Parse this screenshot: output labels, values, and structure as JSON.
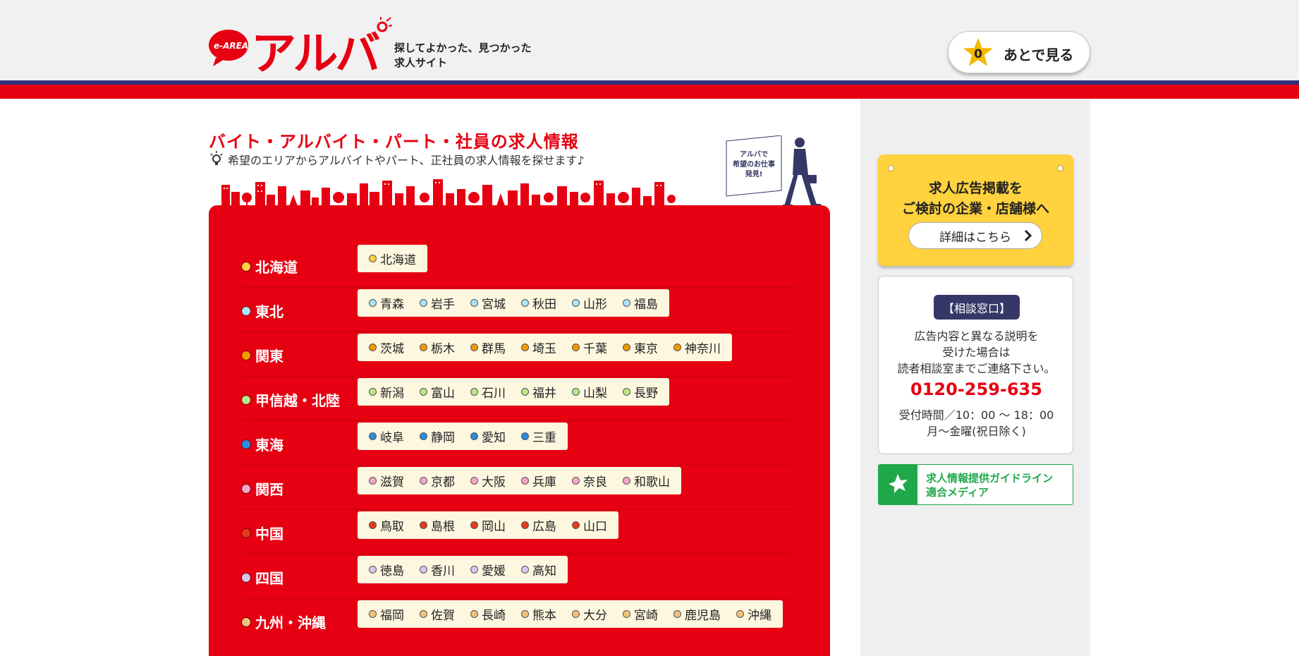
{
  "header": {
    "logo_mark_text": "e-AREA",
    "logo_text": "アルバ",
    "tagline_line1": "探してよかった、見つかった",
    "tagline_line2": "求人サイト",
    "later_count": "0",
    "later_label": "あとで見る",
    "brand_red": "#e60012",
    "brand_navy": "#2e2f7a"
  },
  "main": {
    "title": "バイト・アルバイト・パート・社員の求人情報",
    "subtitle": "希望のエリアからアルバイトやパート、正社員の求人情報を探せます♪",
    "walker_sign_line1": "アルバで",
    "walker_sign_line2": "希望のお仕事",
    "walker_sign_line3": "発見!"
  },
  "regions": [
    {
      "name": "北海道",
      "color": "#ffd23e",
      "prefectures": [
        "北海道"
      ]
    },
    {
      "name": "東北",
      "color": "#a9e4f7",
      "prefectures": [
        "青森",
        "岩手",
        "宮城",
        "秋田",
        "山形",
        "福島"
      ]
    },
    {
      "name": "関東",
      "color": "#f39800",
      "prefectures": [
        "茨城",
        "栃木",
        "群馬",
        "埼玉",
        "千葉",
        "東京",
        "神奈川"
      ]
    },
    {
      "name": "甲信越・北陸",
      "color": "#b5e887",
      "prefectures": [
        "新潟",
        "富山",
        "石川",
        "福井",
        "山梨",
        "長野"
      ]
    },
    {
      "name": "東海",
      "color": "#2a8de0",
      "prefectures": [
        "岐阜",
        "静岡",
        "愛知",
        "三重"
      ]
    },
    {
      "name": "関西",
      "color": "#f4a6c8",
      "prefectures": [
        "滋賀",
        "京都",
        "大阪",
        "兵庫",
        "奈良",
        "和歌山"
      ]
    },
    {
      "name": "中国",
      "color": "#e83a1a",
      "prefectures": [
        "鳥取",
        "島根",
        "岡山",
        "広島",
        "山口"
      ]
    },
    {
      "name": "四国",
      "color": "#d9c6ec",
      "prefectures": [
        "徳島",
        "香川",
        "愛媛",
        "高知"
      ]
    },
    {
      "name": "九州・沖縄",
      "color": "#f1c27d",
      "prefectures": [
        "福岡",
        "佐賀",
        "長崎",
        "熊本",
        "大分",
        "宮崎",
        "鹿児島",
        "沖縄"
      ]
    }
  ],
  "sidebar": {
    "ad_line1": "求人広告掲載を",
    "ad_line2": "ご検討の企業・店舗様へ",
    "ad_button": "詳細はこちら",
    "consult_badge": "【相談窓口】",
    "consult_line1": "広告内容と異なる説明を",
    "consult_line2": "受けた場合は",
    "consult_line3": "読者相談室までご連絡下さい。",
    "consult_phone": "0120-259-635",
    "consult_hours1": "受付時間／10：00 ～ 18：00",
    "consult_hours2": "月～金曜(祝日除く)",
    "guide_line1": "求人情報提供ガイドライン",
    "guide_line2": "適合メディア",
    "guide_color": "#1fa84a"
  }
}
